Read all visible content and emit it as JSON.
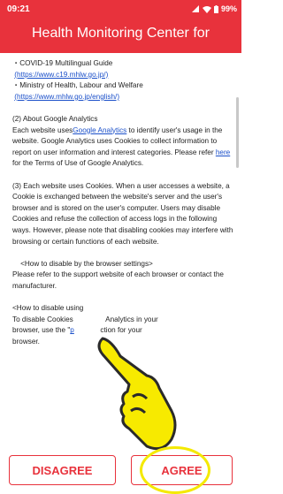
{
  "status_bar": {
    "time": "09:21",
    "battery": "99%"
  },
  "header": {
    "title": "Health Monitoring Center for"
  },
  "content": {
    "line1": "・COVID-19 Multilingual Guide",
    "link1": "(https://www.c19.mhlw.go.jp/)",
    "line2": "・Ministry of Health, Labour and Welfare",
    "link2": "(https://www.mhlw.go.jp/english/)",
    "sec2_title": "(2) About Google Analytics",
    "sec2_a": "Each website uses",
    "sec2_link": "Google Analytics",
    "sec2_b": " to identify user's usage in the website. Google Analytics uses Cookies to collect information to report on user information and interest categories. Please refer",
    "sec2_here": "here",
    "sec2_c": " for the Terms of Use of Google Analytics.",
    "sec3": "(3) Each website uses Cookies. When a user accesses a website, a Cookie is exchanged between the website's server and the user's browser and is stored on the user's computer. Users may disable Cookies and refuse the collection of access logs in the following ways. However, please note that disabling cookies may interfere with browsing or certain functions of each website.",
    "browser_title": "<How to disable by the browser settings>",
    "browser_text": "Please refer to the support website of each browser or contact the manufacturer.",
    "ga_title": "<How to disable using",
    "ga_text_a": "To disable Cookies",
    "ga_text_b": "Analytics in your",
    "ga_text_c": "browser, use the \"",
    "ga_link": "p",
    "ga_text_d": "ction for your",
    "ga_text_e": "browser."
  },
  "buttons": {
    "disagree": "DISAGREE",
    "agree": "AGREE"
  },
  "colors": {
    "accent": "#e8323c",
    "highlight": "#f4e900"
  },
  "icons": {
    "signal": "signal-icon",
    "wifi": "wifi-icon",
    "battery": "battery-icon",
    "hand": "pointing-hand-icon"
  }
}
